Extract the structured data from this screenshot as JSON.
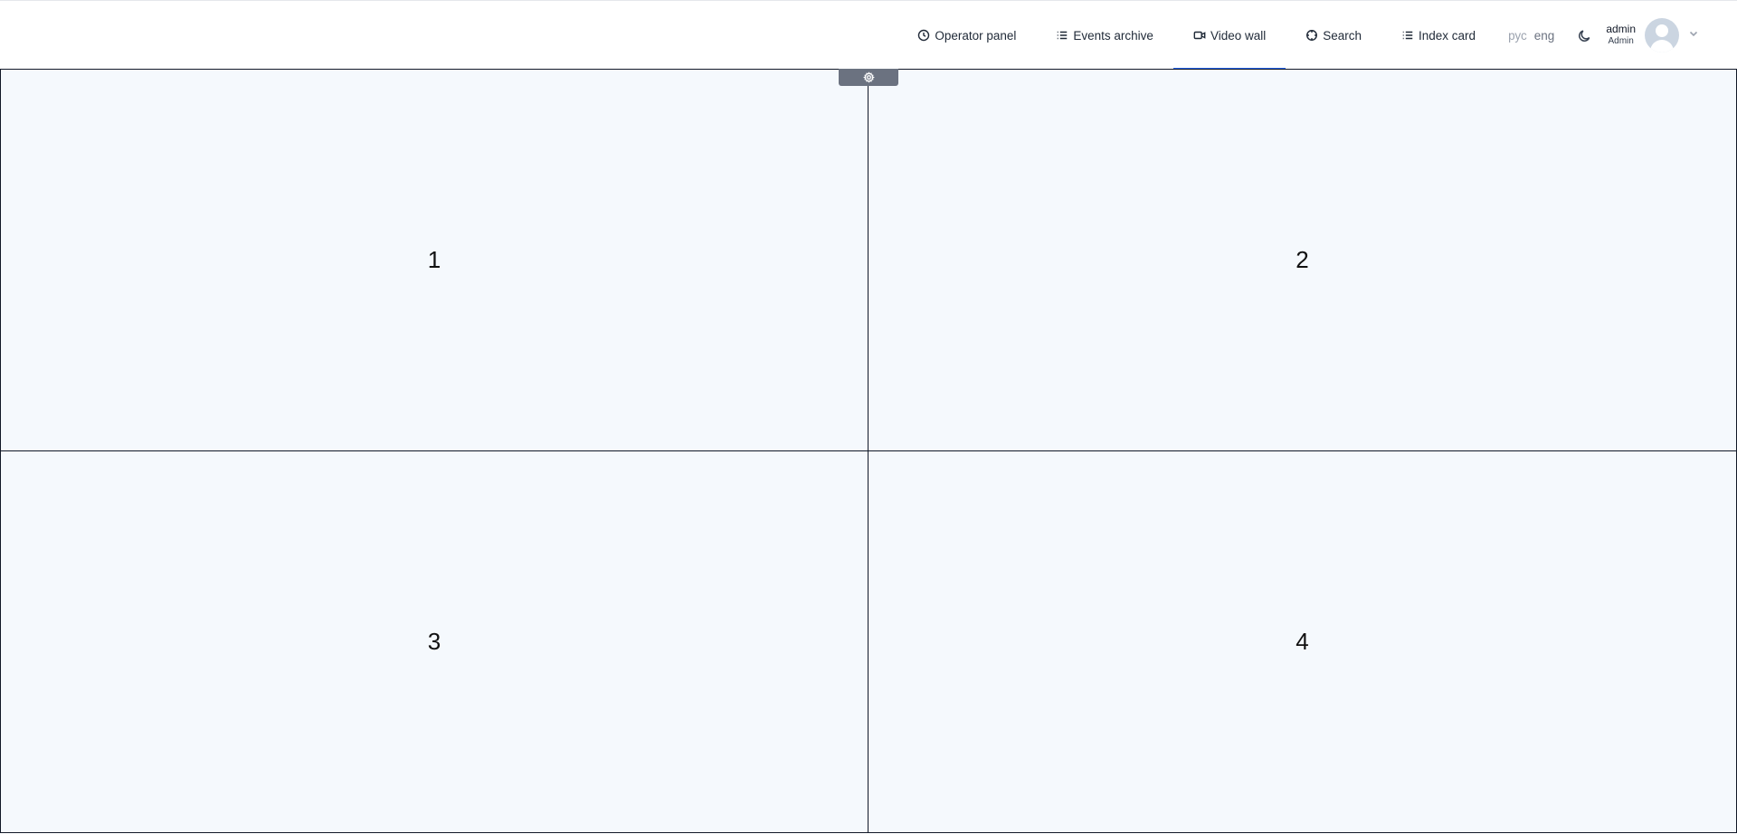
{
  "nav": {
    "items": [
      {
        "label": "Operator panel",
        "icon": "clock-icon"
      },
      {
        "label": "Events archive",
        "icon": "list-icon"
      },
      {
        "label": "Video wall",
        "icon": "video-icon",
        "active": true
      },
      {
        "label": "Search",
        "icon": "crosshair-icon"
      },
      {
        "label": "Index card",
        "icon": "list-icon"
      }
    ]
  },
  "languages": {
    "ru": "рус",
    "en": "eng"
  },
  "user": {
    "name": "admin",
    "role": "Admin"
  },
  "video_wall": {
    "cells": [
      "1",
      "2",
      "3",
      "4"
    ]
  },
  "colors": {
    "accent": "#2563eb",
    "cell_bg": "#f5f9fd",
    "settings_tab": "#6b7280"
  }
}
